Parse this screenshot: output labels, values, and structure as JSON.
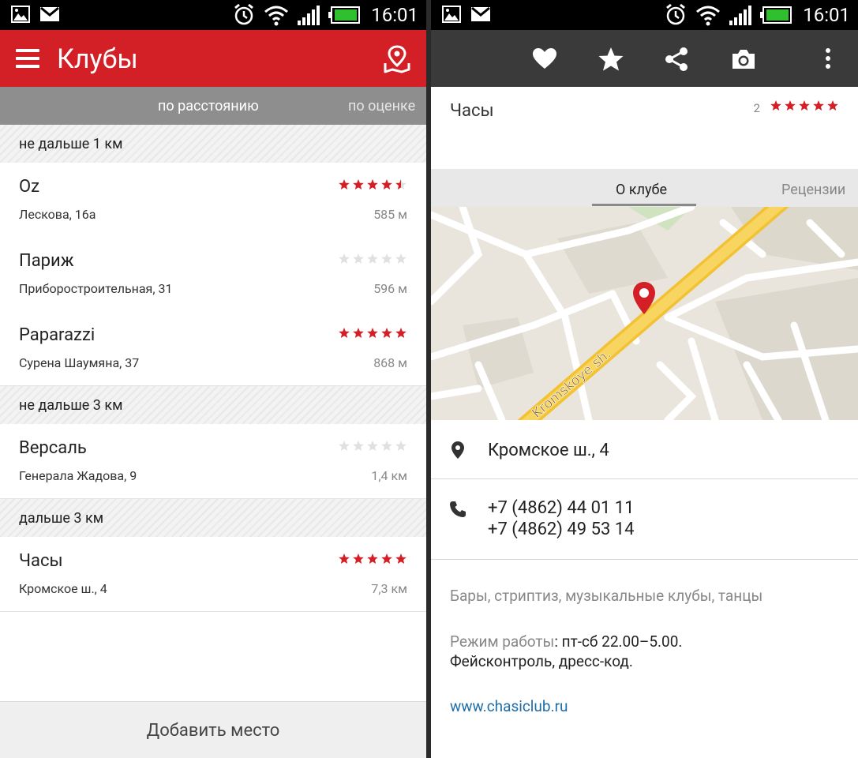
{
  "status": {
    "time": "16:01"
  },
  "left": {
    "title": "Клубы",
    "tabs": [
      {
        "label": "по расстоянию"
      },
      {
        "label": "по оценке"
      }
    ],
    "sections": [
      {
        "label": "не дальше 1 км"
      },
      {
        "label": "не дальше 3 км"
      },
      {
        "label": "дальше 3 км"
      }
    ],
    "items": [
      {
        "name": "Oz",
        "address": "Лескова, 16а",
        "distance": "585 м",
        "rating": 4.5
      },
      {
        "name": "Париж",
        "address": "Приборостроительная, 31",
        "distance": "596 м",
        "rating": 0
      },
      {
        "name": "Paparazzi",
        "address": "Сурена Шаумяна, 37",
        "distance": "868 м",
        "rating": 5
      },
      {
        "name": "Версаль",
        "address": "Генерала Жадова, 9",
        "distance": "1,4 км",
        "rating": 0
      },
      {
        "name": "Часы",
        "address": "Кромское ш., 4",
        "distance": "7,3 км",
        "rating": 5
      }
    ],
    "add_place": "Добавить место"
  },
  "right": {
    "club_name": "Часы",
    "review_count": "2",
    "rating": 5,
    "tabs": [
      {
        "label": "О клубе"
      },
      {
        "label": "Рецензии"
      }
    ],
    "map_street_label": "Kromskoye sh.",
    "address": "Кромское ш., 4",
    "phones": [
      "+7 (4862) 44 01 11",
      "+7 (4862) 49 53 14"
    ],
    "categories": "Бары, стриптиз, музыкальные клубы, танцы",
    "hours_label": "Режим работы",
    "hours_value": ": пт-сб 22.00–5.00.",
    "face_control": "Фейсконтроль, дресс-код.",
    "website": "www.chasiclub.ru"
  },
  "colors": {
    "accent_red": "#d32027",
    "star_red": "#d32027",
    "star_empty": "#e0e0e0",
    "dark_bar": "#3a3a3a",
    "link": "#1f6ea8"
  }
}
